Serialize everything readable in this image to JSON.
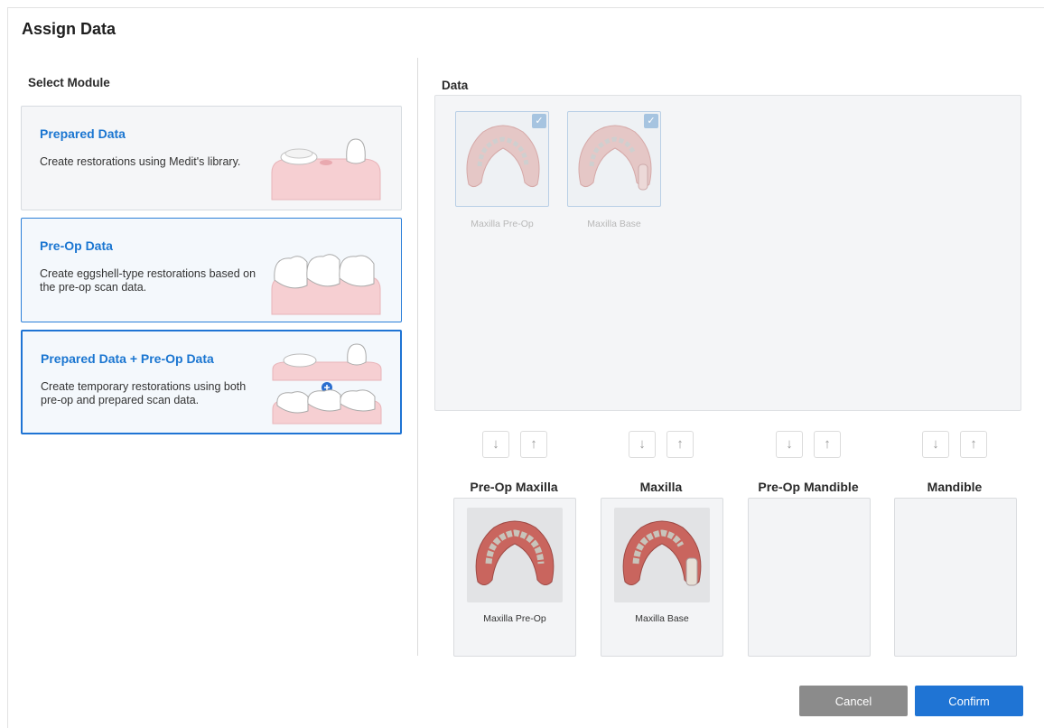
{
  "dialog": {
    "title": "Assign Data"
  },
  "left": {
    "section_label": "Select Module",
    "modules": [
      {
        "title": "Prepared Data",
        "desc": "Create restorations using Medit's library."
      },
      {
        "title": "Pre-Op Data",
        "desc": "Create eggshell-type restorations based on the pre-op scan data."
      },
      {
        "title": "Prepared Data + Pre-Op Data",
        "desc": "Create temporary restorations using both pre-op and prepared scan data."
      }
    ],
    "selected_module": "Prepared Data + Pre-Op Data"
  },
  "right": {
    "section_label": "Data",
    "items": [
      {
        "label": "Maxilla Pre-Op",
        "checked": true
      },
      {
        "label": "Maxilla Base",
        "checked": true
      }
    ],
    "slots": [
      {
        "title": "Pre-Op Maxilla",
        "label": "Maxilla Pre-Op"
      },
      {
        "title": "Maxilla",
        "label": "Maxilla Base"
      },
      {
        "title": "Pre-Op Mandible",
        "label": ""
      },
      {
        "title": "Mandible",
        "label": ""
      }
    ]
  },
  "footer": {
    "cancel_label": "Cancel",
    "confirm_label": "Confirm"
  },
  "colors": {
    "accent": "#1f74d4",
    "cancel": "#8b8b8b",
    "module_title": "#1b76d1"
  },
  "icons": {
    "check": "check-icon",
    "down": "arrow-down-icon",
    "up": "arrow-up-icon",
    "plus": "plus-circle-icon"
  }
}
